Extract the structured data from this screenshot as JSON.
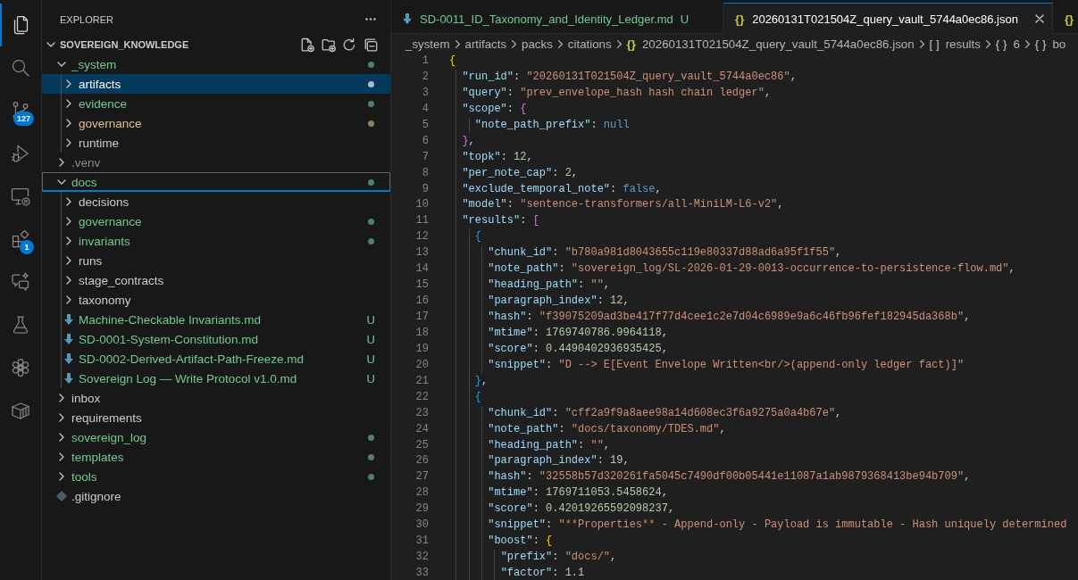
{
  "activity_bar": [
    {
      "kind": "explorer",
      "selected": true
    },
    {
      "kind": "search",
      "selected": false
    },
    {
      "kind": "source_control",
      "selected": false,
      "badge": "127"
    },
    {
      "kind": "run_debug",
      "selected": false
    },
    {
      "kind": "remote",
      "selected": false
    },
    {
      "kind": "extensions",
      "selected": false,
      "badge": "1"
    },
    {
      "kind": "chat",
      "selected": false
    },
    {
      "kind": "testing",
      "selected": false
    },
    {
      "kind": "knot",
      "selected": false
    },
    {
      "kind": "cube",
      "selected": false
    }
  ],
  "explorer": {
    "title": "EXPLORER",
    "workspace": {
      "label": "SOVEREIGN_KNOWLEDGE",
      "expanded": true
    },
    "items": [
      {
        "label": "_system",
        "kind": "folder",
        "color": "#73c991",
        "changes": true,
        "expanded": true,
        "selected": false,
        "focused": false,
        "children": [
          {
            "label": "artifacts",
            "kind": "folder",
            "changes": true,
            "expanded": false,
            "selected": true,
            "focused": false
          },
          {
            "label": "evidence",
            "kind": "folder",
            "color": "#73c991",
            "changes": true,
            "expanded": false,
            "selected": false,
            "focused": false
          },
          {
            "label": "governance",
            "kind": "folder",
            "color": "#e2c08d",
            "changes": true,
            "expanded": false,
            "selected": false,
            "focused": false
          },
          {
            "label": "runtime",
            "kind": "folder",
            "color": "#cccccc",
            "changes": false,
            "expanded": false,
            "selected": false,
            "focused": false
          }
        ]
      },
      {
        "label": ".venv",
        "kind": "folder",
        "color": "#8c8c8c",
        "changes": false,
        "expanded": false,
        "selected": false,
        "focused": false
      },
      {
        "label": "docs",
        "kind": "folder",
        "color": "#73c991",
        "changes": true,
        "expanded": true,
        "selected": false,
        "focused": true,
        "children": [
          {
            "label": "decisions",
            "kind": "folder",
            "color": "#cccccc",
            "changes": false,
            "expanded": false,
            "selected": false,
            "focused": false
          },
          {
            "label": "governance",
            "kind": "folder",
            "color": "#73c991",
            "changes": true,
            "expanded": false,
            "selected": false,
            "focused": false
          },
          {
            "label": "invariants",
            "kind": "folder",
            "color": "#73c991",
            "changes": true,
            "expanded": false,
            "selected": false,
            "focused": false
          },
          {
            "label": "runs",
            "kind": "folder",
            "color": "#cccccc",
            "changes": false,
            "expanded": false,
            "selected": false,
            "focused": false
          },
          {
            "label": "stage_contracts",
            "kind": "folder",
            "color": "#cccccc",
            "changes": false,
            "expanded": false,
            "selected": false,
            "focused": false
          },
          {
            "label": "taxonomy",
            "kind": "folder",
            "color": "#cccccc",
            "changes": false,
            "expanded": false,
            "selected": false,
            "focused": false
          },
          {
            "label": "Machine-Checkable Invariants.md",
            "kind": "markdown",
            "color": "#73c991",
            "badge": "U",
            "selected": false,
            "focused": false
          },
          {
            "label": "SD-0001-System-Constitution.md",
            "kind": "markdown",
            "color": "#73c991",
            "badge": "U",
            "selected": false,
            "focused": false
          },
          {
            "label": "SD-0002-Derived-Artifact-Path-Freeze.md",
            "kind": "markdown",
            "color": "#73c991",
            "badge": "U",
            "selected": false,
            "focused": false
          },
          {
            "label": "Sovereign Log — Write Protocol v1.0.md",
            "kind": "markdown",
            "color": "#73c991",
            "badge": "U",
            "selected": false,
            "focused": false
          }
        ]
      },
      {
        "label": "inbox",
        "kind": "folder",
        "color": "#cccccc",
        "changes": false,
        "expanded": false,
        "selected": false,
        "focused": false
      },
      {
        "label": "requirements",
        "kind": "folder",
        "color": "#cccccc",
        "changes": false,
        "expanded": false,
        "selected": false,
        "focused": false
      },
      {
        "label": "sovereign_log",
        "kind": "folder",
        "color": "#73c991",
        "changes": true,
        "expanded": false,
        "selected": false,
        "focused": false
      },
      {
        "label": "templates",
        "kind": "folder",
        "color": "#73c991",
        "changes": true,
        "expanded": false,
        "selected": false,
        "focused": false
      },
      {
        "label": "tools",
        "kind": "folder",
        "color": "#73c991",
        "changes": true,
        "expanded": false,
        "selected": false,
        "focused": false
      },
      {
        "label": ".gitignore",
        "kind": "gitignore",
        "color": "#cccccc",
        "selected": false,
        "focused": false
      }
    ]
  },
  "editor": {
    "tabs": [
      {
        "kind": "markdown",
        "label": "SD-0011_ID_Taxonomy_and_Identity_Ledger.md",
        "color": "#73c991",
        "badge": "U",
        "selected": false
      },
      {
        "kind": "json",
        "icon": "{}",
        "label": "20260131T021504Z_query_vault_5744a0ec86.json",
        "selected": true
      },
      {
        "kind": "json",
        "icon": "{}",
        "selected": false
      }
    ],
    "breadcrumb": [
      {
        "label": "_system"
      },
      {
        "label": "artifacts"
      },
      {
        "label": "packs"
      },
      {
        "label": "citations"
      },
      {
        "kind": "file",
        "icon": "{}",
        "label": "20260131T021504Z_query_vault_5744a0ec86.json"
      },
      {
        "kind": "symbol",
        "icon": "[ ]",
        "label": "results"
      },
      {
        "kind": "symbol",
        "icon": "{ }",
        "label": "6"
      },
      {
        "kind": "symbol",
        "icon": "{ }",
        "label": "bo"
      }
    ],
    "lines": [
      {
        "number": "1",
        "code": "{"
      },
      {
        "number": "2",
        "code": "  \"run_id\": \"20260131T021504Z_query_vault_5744a0ec86\","
      },
      {
        "number": "3",
        "code": "  \"query\": \"prev_envelope_hash hash chain ledger\","
      },
      {
        "number": "4",
        "code": "  \"scope\": {"
      },
      {
        "number": "5",
        "code": "    \"note_path_prefix\": null"
      },
      {
        "number": "6",
        "code": "  },"
      },
      {
        "number": "7",
        "code": "  \"topk\": 12,"
      },
      {
        "number": "8",
        "code": "  \"per_note_cap\": 2,"
      },
      {
        "number": "9",
        "code": "  \"exclude_temporal_note\": false,"
      },
      {
        "number": "10",
        "code": "  \"model\": \"sentence-transformers/all-MiniLM-L6-v2\","
      },
      {
        "number": "11",
        "code": "  \"results\": ["
      },
      {
        "number": "12",
        "code": "    {"
      },
      {
        "number": "13",
        "code": "      \"chunk_id\": \"b780a981d8043655c119e80337d88ad6a95f1f55\","
      },
      {
        "number": "14",
        "code": "      \"note_path\": \"sovereign_log/SL-2026-01-29-0013-occurrence-to-persistence-flow.md\","
      },
      {
        "number": "15",
        "code": "      \"heading_path\": \"\","
      },
      {
        "number": "16",
        "code": "      \"paragraph_index\": 12,"
      },
      {
        "number": "17",
        "code": "      \"hash\": \"f39075209ad3be417f77d4cee1c2e7d04c6989e9a6c46fb96fef182945da368b\","
      },
      {
        "number": "18",
        "code": "      \"mtime\": 1769740786.9964118,"
      },
      {
        "number": "19",
        "code": "      \"score\": 0.4490402936935425,"
      },
      {
        "number": "20",
        "code": "      \"snippet\": \"D --> E[Event Envelope Written<br/>(append-only ledger fact)]\""
      },
      {
        "number": "21",
        "code": "    },"
      },
      {
        "number": "22",
        "code": "    {"
      },
      {
        "number": "23",
        "code": "      \"chunk_id\": \"cff2a9f9a8aee98a14d608ec3f6a9275a0a4b67e\","
      },
      {
        "number": "24",
        "code": "      \"note_path\": \"docs/taxonomy/TDES.md\","
      },
      {
        "number": "25",
        "code": "      \"heading_path\": \"\","
      },
      {
        "number": "26",
        "code": "      \"paragraph_index\": 19,"
      },
      {
        "number": "27",
        "code": "      \"hash\": \"32558b57d320261fa5045c7490df00b05441e11087a1ab9879368413be94b709\","
      },
      {
        "number": "28",
        "code": "      \"mtime\": 1769711053.5458624,"
      },
      {
        "number": "29",
        "code": "      \"score\": 0.42019265592098237,"
      },
      {
        "number": "30",
        "code": "      \"snippet\": \"**Properties** - Append-only - Payload is immutable - Hash uniquely determined"
      },
      {
        "number": "31",
        "code": "      \"boost\": {"
      },
      {
        "number": "32",
        "code": "        \"prefix\": \"docs/\","
      },
      {
        "number": "33",
        "code": "        \"factor\": 1.1"
      }
    ]
  }
}
